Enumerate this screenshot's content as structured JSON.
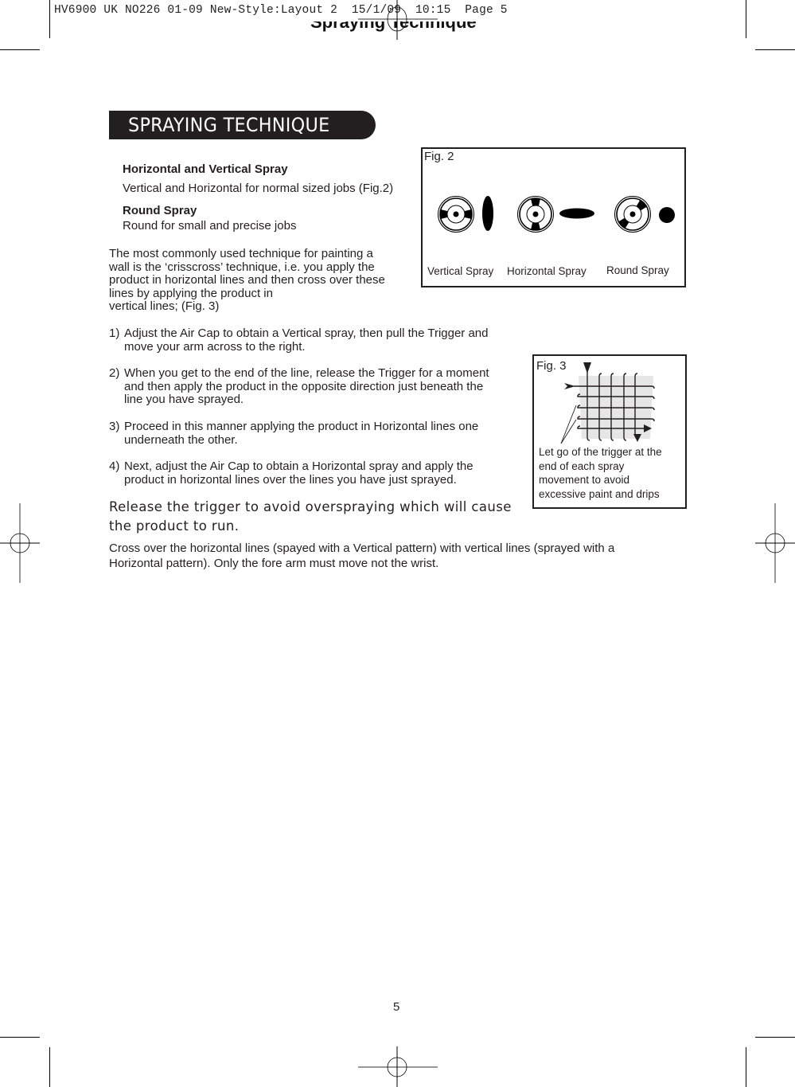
{
  "print_slug": "HV6900 UK NO226 01-09 New-Style:Layout 2  15/1/09  10:15  Page 5",
  "ghost_header": "Spraying Technique",
  "section_title": "SPRAYING TECHNIQUE",
  "spray_types": [
    {
      "heading": "Horizontal and Vertical Spray",
      "description": "Vertical and Horizontal for normal sized jobs (Fig.2)"
    },
    {
      "heading": "Round Spray",
      "description": "Round for small and precise jobs"
    }
  ],
  "intro_lines": [
    "The most commonly used technique for painting a",
    "wall is the ‘crisscross’ technique, i.e. you apply the",
    "product in horizontal lines and then cross over these",
    "lines by applying the product in",
    "vertical lines; (Fig. 3)"
  ],
  "steps": [
    {
      "num": "1)",
      "lines": [
        "Adjust the Air Cap to obtain a Vertical spray, then pull the Trigger and",
        "move your arm across to the right."
      ]
    },
    {
      "num": "2)",
      "lines": [
        "When you get to the end of the line, release the Trigger for a moment",
        "and then apply the  product in the opposite direction just beneath the",
        "line you have sprayed."
      ]
    },
    {
      "num": "3)",
      "lines": [
        "Proceed in this manner applying the product in Horizontal lines one",
        "underneath the other."
      ]
    },
    {
      "num": "4)",
      "lines": [
        "Next, adjust the Air Cap to obtain a Horizontal spray and apply the",
        "product in horizontal lines over the lines you have just sprayed."
      ]
    }
  ],
  "release_note": [
    "Release the trigger to avoid overspraying which will cause",
    "the product to run."
  ],
  "crossover_note": [
    "Cross over the horizontal lines (spayed with a Vertical pattern) with vertical lines (sprayed with a",
    "Horizontal pattern).  Only the fore arm must move not the wrist."
  ],
  "fig2": {
    "label": "Fig. 2",
    "items": [
      {
        "caption": "Vertical Spray",
        "icon": "air-cap-vertical-icon",
        "pattern": "vertical-ellipse"
      },
      {
        "caption": "Horizontal Spray",
        "icon": "air-cap-horizontal-icon",
        "pattern": "horizontal-ellipse"
      },
      {
        "caption": "Round Spray",
        "icon": "air-cap-round-icon",
        "pattern": "round-dot"
      }
    ]
  },
  "fig3": {
    "label": "Fig. 3",
    "caption": [
      "Let go of the trigger at the",
      "end of each spray",
      "movement to avoid",
      "excessive paint and drips"
    ]
  },
  "page_number": "5",
  "colors": {
    "ink": "#231f20",
    "fig3_fill": "#e6e6e6",
    "registration_gray": "#999999"
  }
}
